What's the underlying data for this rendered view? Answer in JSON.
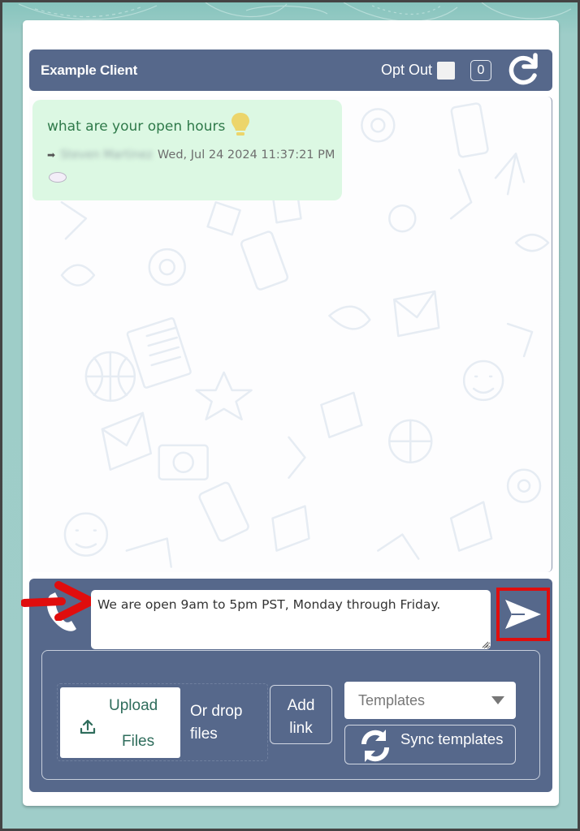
{
  "header": {
    "client_name": "Example Client",
    "opt_out_label": "Opt Out",
    "opt_out_checked": false,
    "unread_count": "0",
    "refresh_icon": "refresh-icon"
  },
  "chat": {
    "messages": [
      {
        "text": "what are your open hours",
        "emoji_icon": "lightbulb-icon",
        "direction_icon": "forward-arrow-icon",
        "sender": "Steven Martinez",
        "sender_redacted": true,
        "timestamp": "Wed, Jul 24 2024 11:37:21 PM",
        "reaction_icon": "cloud-icon"
      }
    ]
  },
  "composer": {
    "channel_icon": "phone-icon",
    "message_value": "We are open 9am to 5pm PST, Monday through Friday.",
    "send_icon": "send-icon",
    "annotation": {
      "arrow_color": "#e00d0d",
      "highlight_color": "#e00d0d"
    },
    "upload": {
      "line1": "Upload",
      "line2": "Files",
      "icon": "upload-icon",
      "drop_text": "Or drop files"
    },
    "add_link": {
      "line1": "Add",
      "line2": "link"
    },
    "templates": {
      "selected": "Templates"
    },
    "sync_templates_label": "Sync templates"
  },
  "colors": {
    "panel": "#56688b",
    "bubble": "#dcf8e3",
    "bubble_text": "#2f7a4a",
    "page_bg": "#9fcdc9"
  }
}
